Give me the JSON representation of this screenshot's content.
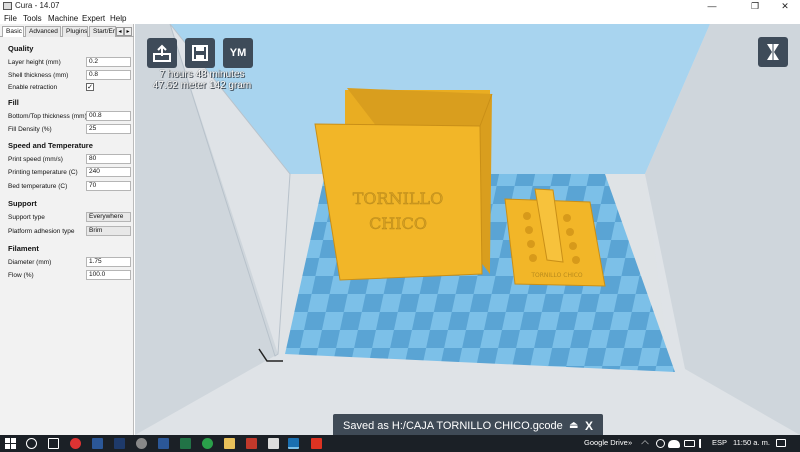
{
  "window": {
    "title": "Cura - 14.07"
  },
  "menu": [
    "File",
    "Tools",
    "Machine",
    "Expert",
    "Help"
  ],
  "tabs": [
    "Basic",
    "Advanced",
    "Plugins",
    "Start/Er"
  ],
  "settings": {
    "quality_title": "Quality",
    "layer_height_label": "Layer height (mm)",
    "layer_height": "0.2",
    "shell_label": "Shell thickness (mm)",
    "shell": "0.8",
    "retraction_label": "Enable retraction",
    "retraction_check": "✓",
    "fill_title": "Fill",
    "bottom_top_label": "Bottom/Top thickness (mm)",
    "bottom_top": "00.8",
    "fill_density_label": "Fill Density (%)",
    "fill_density": "25",
    "speed_title": "Speed and Temperature",
    "print_speed_label": "Print speed (mm/s)",
    "print_speed": "80",
    "print_temp_label": "Printing temperature (C)",
    "print_temp": "240",
    "bed_temp_label": "Bed temperature (C)",
    "bed_temp": "70",
    "support_title": "Support",
    "support_type_label": "Support type",
    "support_type": "Everywhere",
    "adhesion_label": "Platform adhesion type",
    "adhesion": "Brim",
    "filament_title": "Filament",
    "diameter_label": "Diameter (mm)",
    "diameter": "1.75",
    "flow_label": "Flow (%)",
    "flow": "100.0"
  },
  "viewport": {
    "ym_label": "YM",
    "print_time": "7 hours 48 minutes",
    "print_material": "47.62 meter 142 gram",
    "model_text_line1": "TORNILLO",
    "model_text_line2": "CHICO",
    "part_text": "TORNILLO CHICO",
    "model_color": "#f2b628",
    "platform_color": "#5ba6d6"
  },
  "toast": {
    "message": "Saved as H:/CAJA TORNILLO CHICO.gcode",
    "eject": "⏏",
    "close": "X"
  },
  "taskbar": {
    "google_drive": "Google Drive",
    "chevron": "»",
    "language": "ESP",
    "clock": "11:50 a. m."
  }
}
